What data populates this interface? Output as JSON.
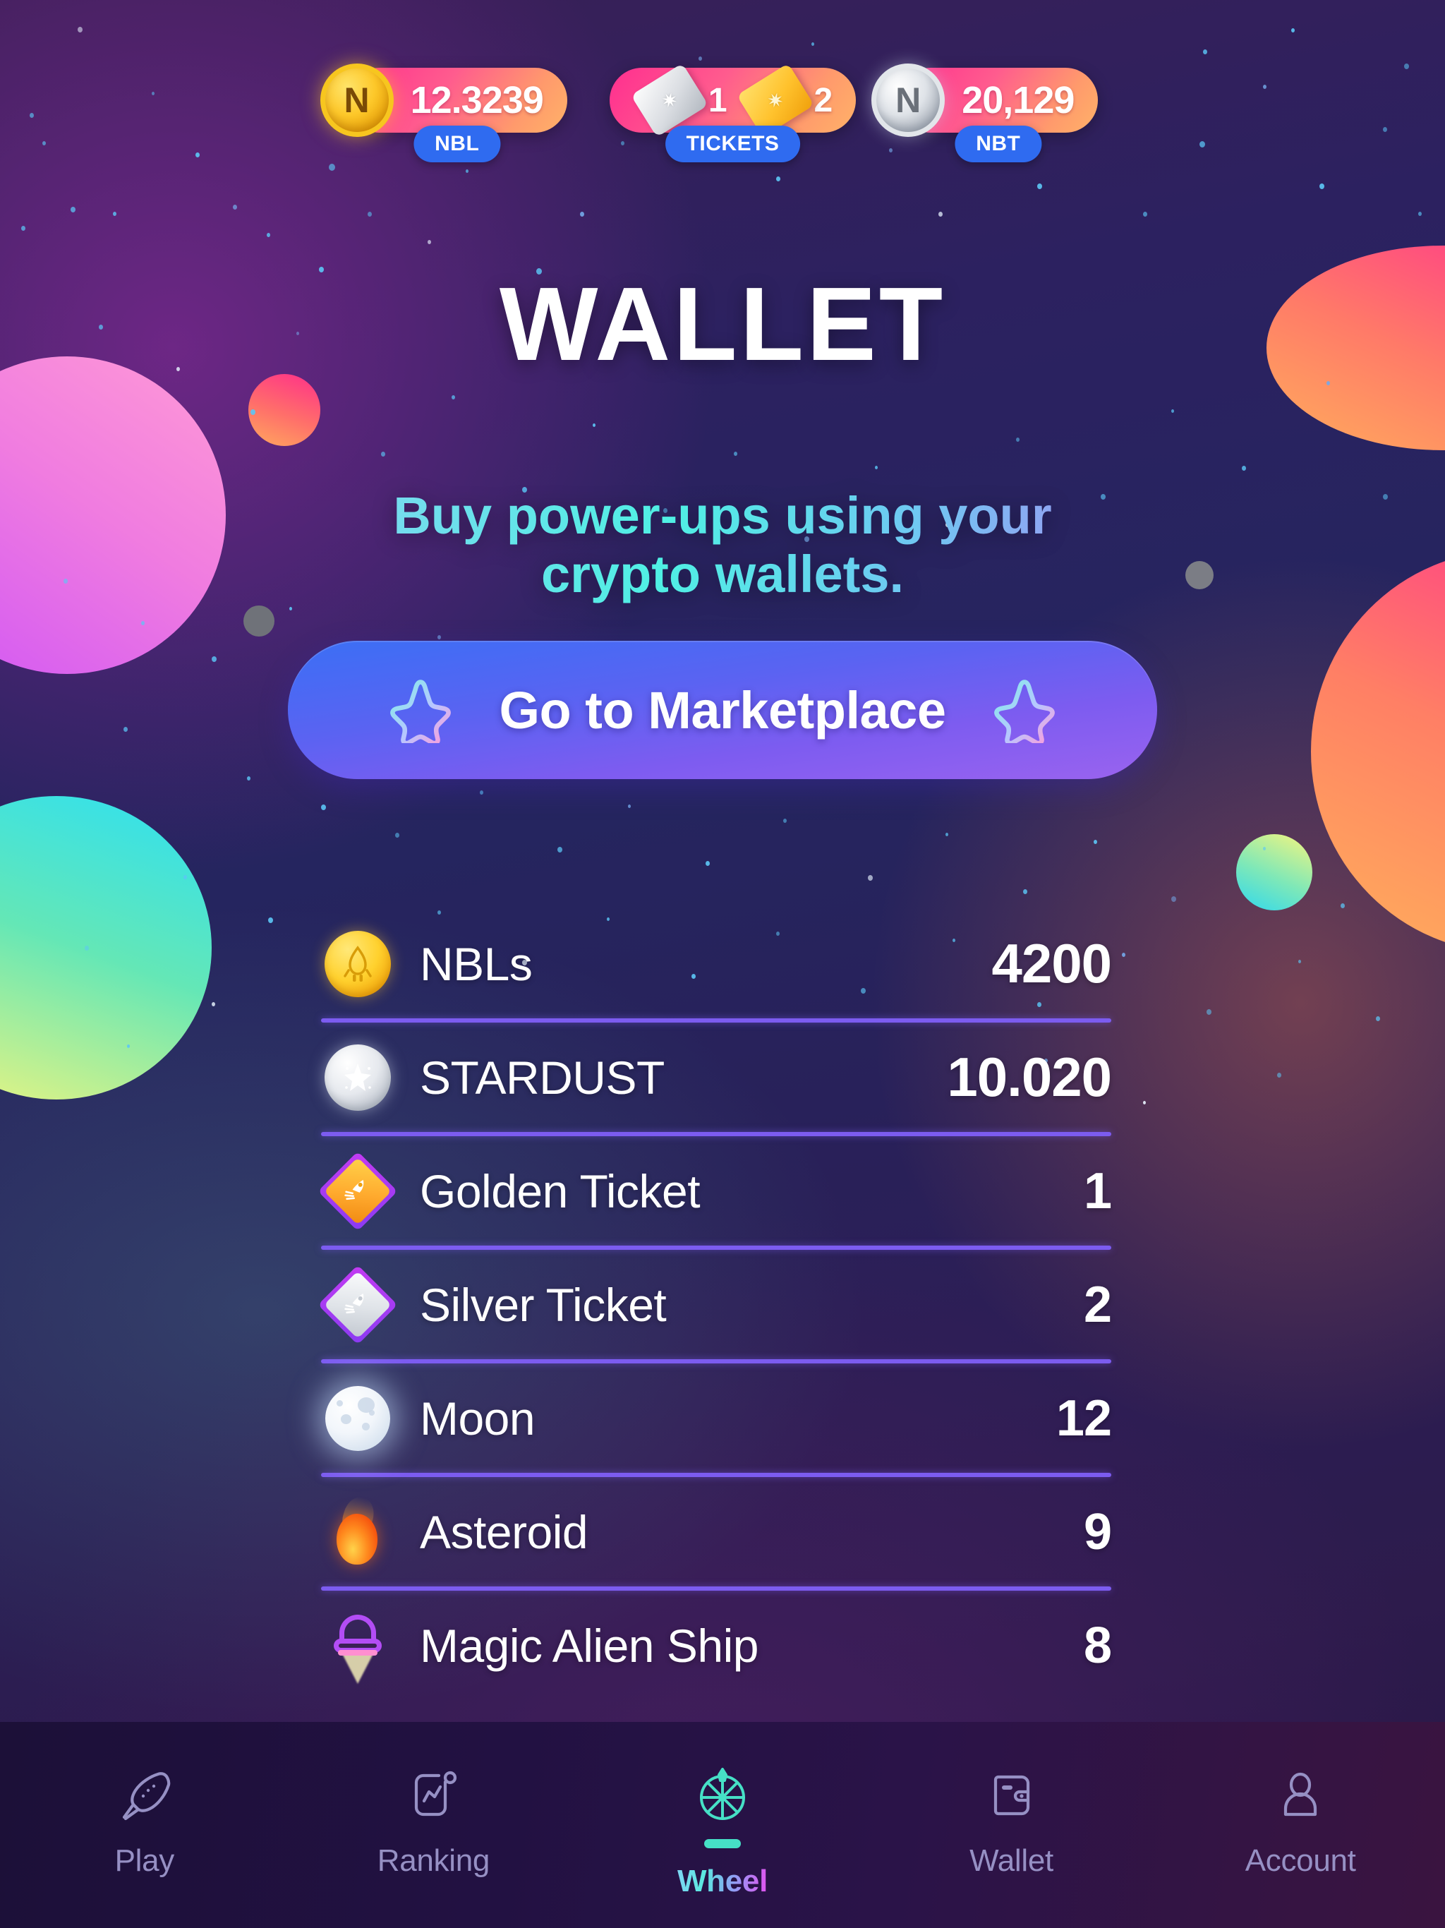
{
  "topbar": {
    "items": [
      {
        "icon": "gold-coin-icon",
        "glyph": "N",
        "amount": "12.3239",
        "tag": "NBL",
        "type": "coin-gold"
      },
      {
        "icon": "tickets-icon",
        "silver_count": "1",
        "gold_count": "2",
        "tag": "TICKETS",
        "type": "tickets"
      },
      {
        "icon": "silver-coin-icon",
        "glyph": "N",
        "amount": "20,129",
        "tag": "NBT",
        "type": "coin-silver"
      }
    ]
  },
  "header": {
    "title": "WALLET",
    "subtitle_line1": "Buy power-ups using your",
    "subtitle_line2": "crypto wallets."
  },
  "marketplace_button": {
    "label": "Go to Marketplace",
    "left_icon": "star-outline-icon",
    "right_icon": "star-outline-icon"
  },
  "wallet_list": [
    {
      "icon": "nbl-gold-coin-icon",
      "name": "NBLs",
      "value": "4200"
    },
    {
      "icon": "stardust-silver-icon",
      "name": "STARDUST",
      "value": "10.020"
    },
    {
      "icon": "golden-ticket-icon",
      "name": "Golden Ticket",
      "value": "1"
    },
    {
      "icon": "silver-ticket-icon",
      "name": "Silver Ticket",
      "value": "2"
    },
    {
      "icon": "moon-icon",
      "name": "Moon",
      "value": "12"
    },
    {
      "icon": "asteroid-icon",
      "name": "Asteroid",
      "value": "9"
    },
    {
      "icon": "magic-alien-ship-icon",
      "name": "Magic Alien Ship",
      "value": "8"
    }
  ],
  "nav": {
    "items": [
      {
        "label": "Play",
        "icon": "rocket-icon",
        "active": false
      },
      {
        "label": "Ranking",
        "icon": "chart-icon",
        "active": false
      },
      {
        "label": "Wheel",
        "icon": "wheel-icon",
        "active": true
      },
      {
        "label": "Wallet",
        "icon": "wallet-icon",
        "active": false
      },
      {
        "label": "Account",
        "icon": "person-icon",
        "active": false
      }
    ]
  },
  "colors": {
    "pill_gradient_start": "#ff2f8f",
    "pill_gradient_end": "#ffb268",
    "tag_blue": "#2f6bf0",
    "divider_purple": "#7c5cf0",
    "button_gradient_start": "#3b6ff5",
    "button_gradient_end": "#9a63ef",
    "nav_inactive": "#9690c4",
    "nav_active_accent": "#46e0c6",
    "background_base": "#2a1a4d"
  }
}
